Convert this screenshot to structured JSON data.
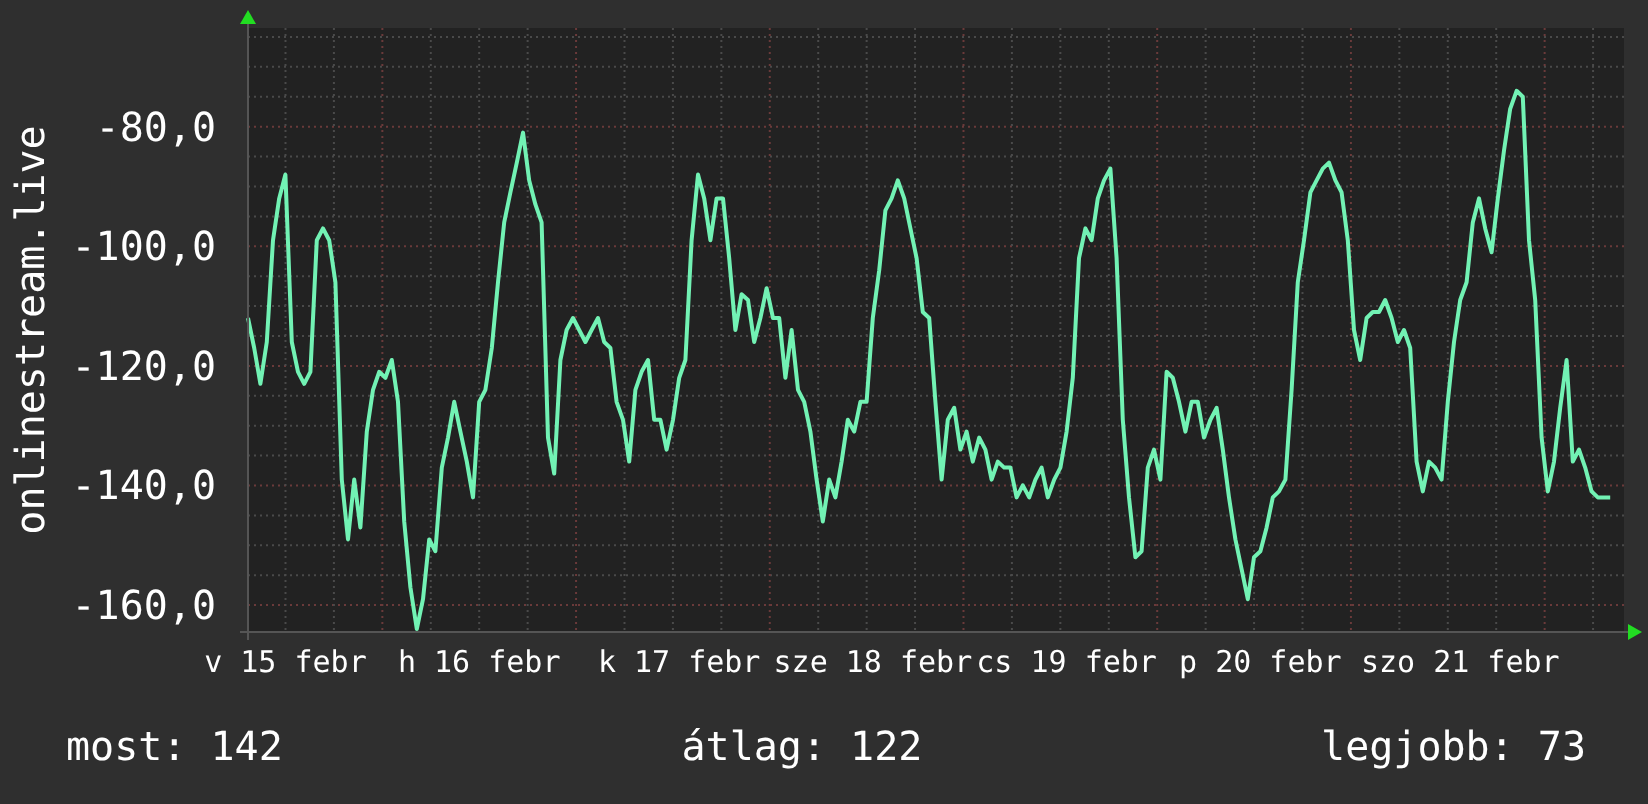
{
  "chart": {
    "chart_data": {
      "type": "line",
      "ylabel": "onlinestream.live",
      "categories": [
        null,
        null,
        null,
        null,
        null,
        null,
        "v 15 febr",
        null,
        null,
        null,
        null,
        null,
        null,
        null,
        null,
        null,
        null,
        null,
        null,
        null,
        null,
        null,
        null,
        null,
        null,
        null,
        null,
        null,
        null,
        null,
        null,
        null,
        null,
        null,
        null,
        null,
        null,
        "h 16 febr",
        null,
        null,
        null,
        null,
        null,
        null,
        null,
        null,
        null,
        null,
        null,
        null,
        null,
        null,
        null,
        null,
        null,
        null,
        null,
        null,
        null,
        null,
        null,
        null,
        null,
        null,
        null,
        null,
        null,
        null,
        null,
        "k 17 febr",
        null,
        null,
        null,
        null,
        null,
        null,
        null,
        null,
        null,
        null,
        null,
        null,
        null,
        null,
        null,
        null,
        null,
        null,
        null,
        null,
        null,
        null,
        null,
        null,
        null,
        null,
        null,
        null,
        null,
        null,
        "sze 18 febr",
        null,
        null,
        null,
        null,
        null,
        null,
        null,
        null,
        null,
        null,
        null,
        null,
        null,
        null,
        null,
        null,
        null,
        null,
        null,
        null,
        null,
        null,
        null,
        null,
        null,
        null,
        null,
        null,
        null,
        null,
        "cs 19 febr",
        null,
        null,
        null,
        null,
        null,
        null,
        null,
        null,
        null,
        null,
        null,
        null,
        null,
        null,
        null,
        null,
        null,
        null,
        null,
        null,
        null,
        null,
        null,
        null,
        null,
        null,
        null,
        null,
        null,
        null,
        "p 20 febr",
        null,
        null,
        null,
        null,
        null,
        null,
        null,
        null,
        null,
        null,
        null,
        null,
        null,
        null,
        null,
        null,
        null,
        null,
        null,
        null,
        null,
        null,
        null,
        null,
        null,
        null,
        null,
        null,
        null,
        null,
        null,
        "szo 21 febr",
        null,
        null,
        null,
        null,
        null,
        null,
        null,
        null,
        null,
        null,
        null,
        null,
        null,
        null,
        null,
        null,
        null,
        null,
        null,
        null,
        null,
        null,
        null,
        null
      ],
      "series": [
        {
          "color": "#72f2b4",
          "values": [
            -112,
            -117,
            -123,
            -116,
            -99,
            -92,
            -88,
            -116,
            -121,
            -123,
            -121,
            -99,
            -97,
            -99,
            -106,
            -139,
            -149,
            -139,
            -147,
            -131,
            -124,
            -121,
            -122,
            -119,
            -126,
            -146,
            -157,
            -164,
            -159,
            -149,
            -151,
            -137,
            -132,
            -126,
            -131,
            -136,
            -142,
            -126,
            -124,
            -117,
            -106,
            -96,
            -91,
            -86,
            -81,
            -89,
            -93,
            -96,
            -132,
            -138,
            -119,
            -114,
            -112,
            -114,
            -116,
            -114,
            -112,
            -116,
            -117,
            -126,
            -129,
            -136,
            -124,
            -121,
            -119,
            -129,
            -129,
            -134,
            -129,
            -122,
            -119,
            -99,
            -88,
            -92,
            -99,
            -92,
            -92,
            -102,
            -114,
            -108,
            -109,
            -116,
            -112,
            -107,
            -112,
            -112,
            -122,
            -114,
            -124,
            -126,
            -131,
            -139,
            -146,
            -139,
            -142,
            -136,
            -129,
            -131,
            -126,
            -126,
            -112,
            -104,
            -94,
            -92,
            -89,
            -92,
            -97,
            -102,
            -111,
            -112,
            -126,
            -139,
            -129,
            -127,
            -134,
            -131,
            -136,
            -132,
            -134,
            -139,
            -136,
            -137,
            -137,
            -142,
            -140,
            -142,
            -139,
            -137,
            -142,
            -139,
            -137,
            -131,
            -122,
            -102,
            -97,
            -99,
            -92,
            -89,
            -87,
            -102,
            -129,
            -142,
            -152,
            -151,
            -137,
            -134,
            -139,
            -121,
            -122,
            -126,
            -131,
            -126,
            -126,
            -132,
            -129,
            -127,
            -134,
            -142,
            -149,
            -154,
            -159,
            -152,
            -151,
            -147,
            -142,
            -141,
            -139,
            -124,
            -106,
            -99,
            -91,
            -89,
            -87,
            -86,
            -89,
            -91,
            -99,
            -114,
            -119,
            -112,
            -111,
            -111,
            -109,
            -112,
            -116,
            -114,
            -117,
            -136,
            -141,
            -136,
            -137,
            -139,
            -126,
            -116,
            -109,
            -106,
            -96,
            -92,
            -97,
            -101,
            -92,
            -84,
            -77,
            -74,
            -75,
            -99,
            -109,
            -132,
            -141,
            -136,
            -127,
            -119,
            -136,
            -134,
            -137,
            -141,
            -142,
            -142,
            -142
          ]
        }
      ],
      "grid": true,
      "ylim": [
        -164.5,
        -63.5
      ],
      "yticks": [
        {
          "value": -80,
          "label": "-80,0"
        },
        {
          "value": -100,
          "label": "-100,0"
        },
        {
          "value": -120,
          "label": "-120,0"
        },
        {
          "value": -140,
          "label": "-140,0"
        },
        {
          "value": -160,
          "label": "-160,0"
        }
      ]
    }
  },
  "stats": [
    "most: 142",
    "átlag: 122",
    "legjobb: 73"
  ]
}
